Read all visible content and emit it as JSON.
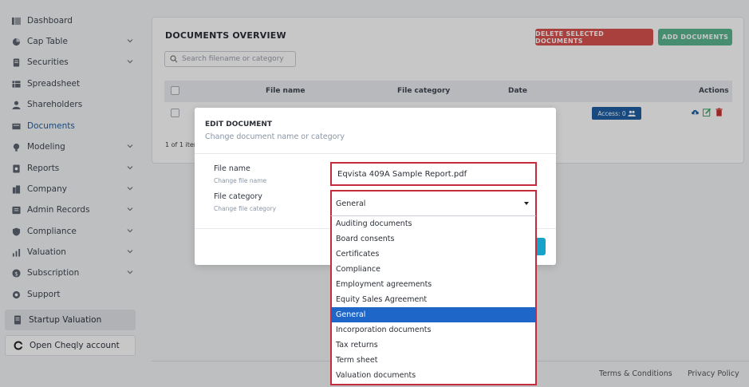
{
  "sidebar": {
    "items": [
      {
        "label": "Dashboard",
        "icon": "dashboard-icon",
        "chevron": false
      },
      {
        "label": "Cap Table",
        "icon": "pie-chart-icon",
        "chevron": true
      },
      {
        "label": "Securities",
        "icon": "document-icon",
        "chevron": true
      },
      {
        "label": "Spreadsheet",
        "icon": "table-icon",
        "chevron": false
      },
      {
        "label": "Shareholders",
        "icon": "user-icon",
        "chevron": false
      },
      {
        "label": "Documents",
        "icon": "folder-icon",
        "chevron": false
      },
      {
        "label": "Modeling",
        "icon": "bulb-icon",
        "chevron": true
      },
      {
        "label": "Reports",
        "icon": "reports-icon",
        "chevron": true
      },
      {
        "label": "Company",
        "icon": "building-icon",
        "chevron": true
      },
      {
        "label": "Admin Records",
        "icon": "records-icon",
        "chevron": true
      },
      {
        "label": "Compliance",
        "icon": "shield-icon",
        "chevron": true
      },
      {
        "label": "Valuation",
        "icon": "valuation-icon",
        "chevron": true
      },
      {
        "label": "Subscription",
        "icon": "dollar-icon",
        "chevron": true
      },
      {
        "label": "Support",
        "icon": "support-icon",
        "chevron": false
      }
    ],
    "startup_valuation": "Startup Valuation",
    "open_cheqly": "Open Cheqly account"
  },
  "overview": {
    "title": "DOCUMENTS OVERVIEW",
    "delete_btn": "DELETE SELECTED DOCUMENTS",
    "add_btn": "ADD DOCUMENTS",
    "search_placeholder": "Search filename or category",
    "columns": [
      "File name",
      "File category",
      "Date",
      "Actions"
    ],
    "access_badge": "Access: 0",
    "items_count": "1 of 1 item"
  },
  "modal": {
    "title": "EDIT DOCUMENT",
    "subtitle": "Change document name or category",
    "file_name_label": "File name",
    "file_name_hint": "Change file name",
    "file_name_value": "Eqvista 409A Sample Report.pdf",
    "file_category_label": "File category",
    "file_category_hint": "Change file category",
    "selected_category": "General",
    "options": [
      "Auditing documents",
      "Board consents",
      "Certificates",
      "Compliance",
      "Employment agreements",
      "Equity Sales Agreement",
      "General",
      "Incorporation documents",
      "Tax returns",
      "Term sheet",
      "Valuation documents"
    ],
    "selected_index": 6
  },
  "footer": {
    "terms": "Terms & Conditions",
    "privacy": "Privacy Policy"
  },
  "colors": {
    "accent_blue": "#1f5fa5",
    "danger_red": "#d9534f",
    "success_green": "#5cb58f",
    "highlight_red": "#c62b3b",
    "selected_option": "#1f66c9"
  }
}
